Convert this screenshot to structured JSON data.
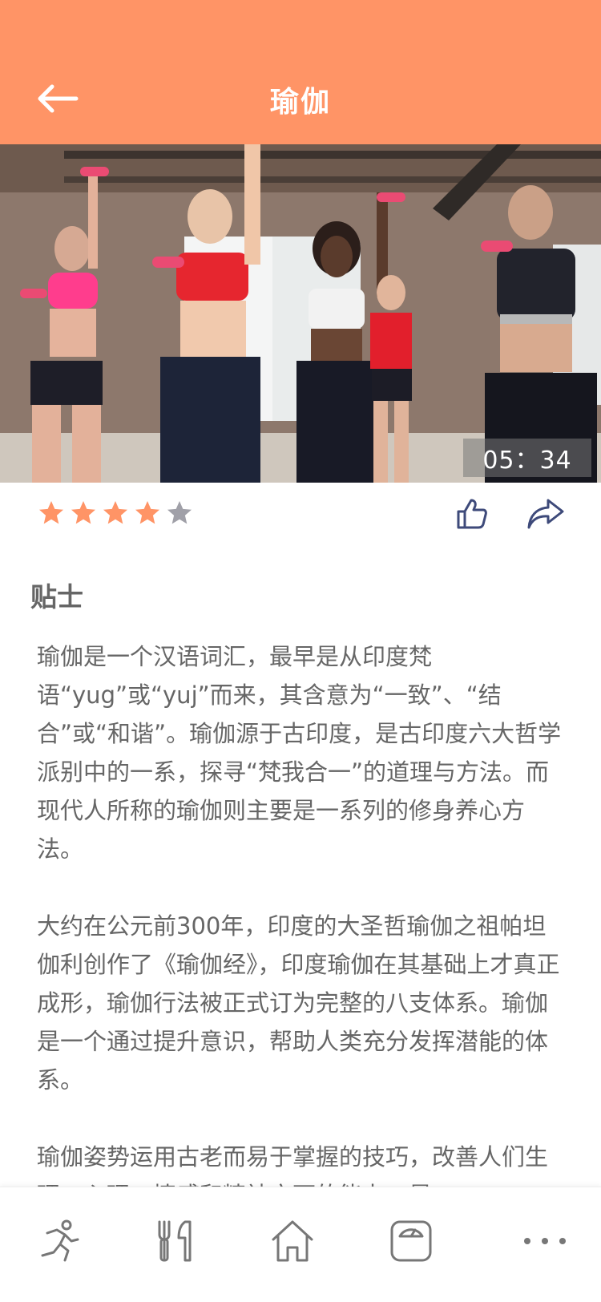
{
  "header": {
    "title": "瑜伽"
  },
  "video": {
    "timer": "05：34"
  },
  "rating": {
    "value": 4,
    "max": 5
  },
  "colors": {
    "accent": "#FF9466",
    "star_off": "#A0A0A8",
    "icon": "#3E4A7A",
    "nav_icon": "#777777"
  },
  "tips": {
    "title": "贴士",
    "paragraphs": [
      "瑜伽是一个汉语词汇，最早是从印度梵语“yug”或“yuj”而来，其含意为“一致”、“结合”或“和谐”。瑜伽源于古印度，是古印度六大哲学派别中的一系，探寻“梵我合一”的道理与方法。而现代人所称的瑜伽则主要是一系列的修身养心方法。",
      "大约在公元前300年，印度的大圣哲瑜伽之祖帕坦伽利创作了《瑜伽经》，印度瑜伽在其基础上才真正成形，瑜伽行法被正式订为完整的八支体系。瑜伽是一个通过提升意识，帮助人类充分发挥潜能的体系。",
      "瑜伽姿势运用古老而易于掌握的技巧，改善人们生理、心理、情感和精神方面的能力，是"
    ]
  },
  "bottom_nav": {
    "items": [
      {
        "icon": "running-icon"
      },
      {
        "icon": "utensils-icon"
      },
      {
        "icon": "home-icon"
      },
      {
        "icon": "scale-icon"
      },
      {
        "icon": "more-icon"
      }
    ]
  }
}
